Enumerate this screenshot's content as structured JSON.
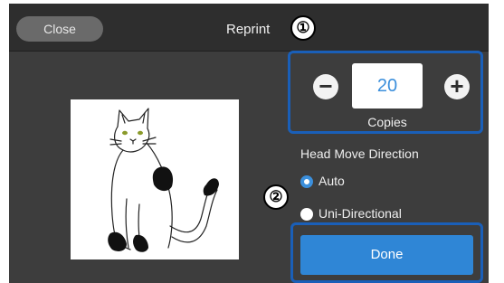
{
  "header": {
    "close_label": "Close",
    "title": "Reprint"
  },
  "copies": {
    "value": "20",
    "label": "Copies",
    "decrease_icon": "minus-icon",
    "increase_icon": "plus-icon"
  },
  "head_move_direction": {
    "title": "Head Move Direction",
    "options": [
      {
        "label": "Auto",
        "selected": true
      },
      {
        "label": "Uni-Directional",
        "selected": false
      }
    ]
  },
  "done_label": "Done",
  "callouts": {
    "first": "①",
    "second": "②"
  },
  "colors": {
    "accent": "#2f86d6",
    "callout_border": "#1a5fb8"
  },
  "preview": {
    "image": "cat-illustration"
  }
}
